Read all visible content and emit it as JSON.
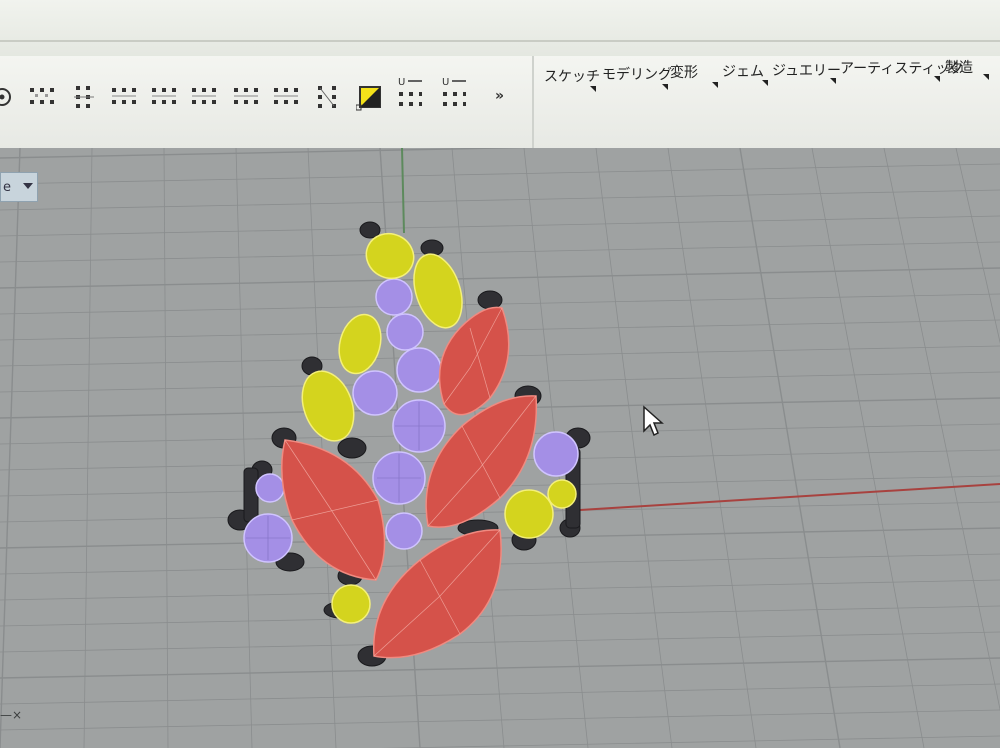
{
  "toolbar": {
    "expand_label": "»",
    "icons": [
      "record-icon",
      "points-on-icon",
      "points-off-icon",
      "control-points-icon",
      "edit-points-icon",
      "grip-icon",
      "handlebar-icon",
      "point-grid-icon",
      "node-icon",
      "selection-toggle-icon",
      "move-uvn-icon",
      "move-uvn-alt-icon"
    ],
    "tabs": [
      {
        "label": "スケッチ"
      },
      {
        "label": "モデリング"
      },
      {
        "label": "変形"
      },
      {
        "label": "ジェム"
      },
      {
        "label": "ジュエリー"
      },
      {
        "label": "アーティスティック"
      },
      {
        "label": "製造"
      }
    ]
  },
  "viewport": {
    "label": "e",
    "axis_text": "—×"
  },
  "colors": {
    "viewport_bg": "#9fa2a2",
    "grid_line": "#8a8d8e",
    "x_axis": "#a8423f",
    "y_axis": "#5d8a5d",
    "gem_red": "#d5524a",
    "gem_red_wire": "#f08a80",
    "gem_yellow": "#d4d41e",
    "gem_yellow_wire": "#f4f07a",
    "gem_purple": "#a48fe6",
    "gem_purple_wire": "#d0c4ff",
    "prong_dark": "#2f2f33"
  }
}
